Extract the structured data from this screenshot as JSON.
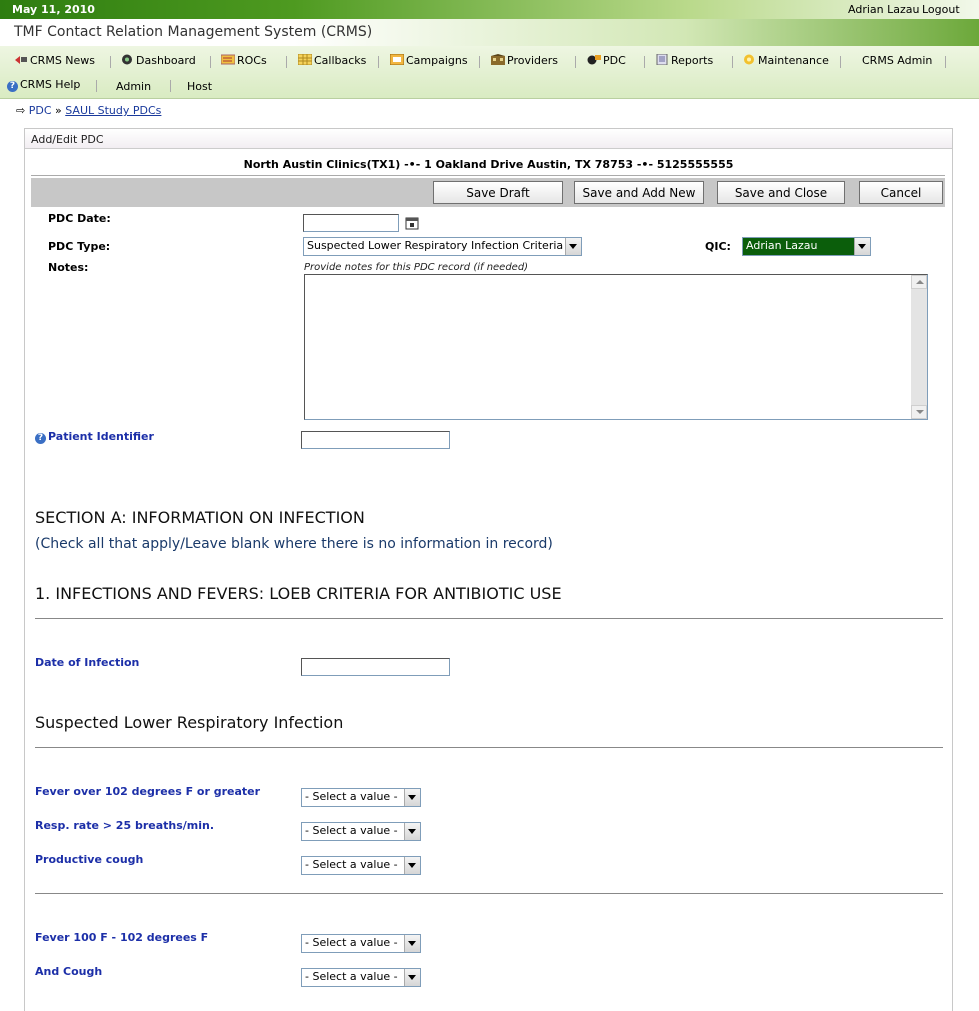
{
  "header": {
    "date": "May 11, 2010",
    "user": "Adrian Lazau",
    "logout": "Logout",
    "app_title": "TMF Contact Relation Management System (CRMS)"
  },
  "nav": [
    {
      "label": "CRMS News",
      "icon": "news-icon"
    },
    {
      "label": "Dashboard",
      "icon": "dashboard-icon"
    },
    {
      "label": "ROCs",
      "icon": "rocs-icon"
    },
    {
      "label": "Callbacks",
      "icon": "callbacks-icon"
    },
    {
      "label": "Campaigns",
      "icon": "campaigns-icon"
    },
    {
      "label": "Providers",
      "icon": "providers-icon"
    },
    {
      "label": "PDC",
      "icon": "pdc-icon"
    },
    {
      "label": "Reports",
      "icon": "reports-icon"
    },
    {
      "label": "Maintenance",
      "icon": "maintenance-icon"
    },
    {
      "label": "CRMS Admin",
      "icon": ""
    },
    {
      "label": "CRMS Help",
      "icon": "help-icon"
    },
    {
      "label": "Admin",
      "icon": ""
    },
    {
      "label": "Host",
      "icon": ""
    }
  ],
  "breadcrumb": {
    "root": "PDC",
    "separator": "»",
    "current": "SAUL Study PDCs"
  },
  "panel": {
    "title": "Add/Edit PDC",
    "provider_info": "North Austin Clinics(TX1)  -•-  1 Oakland Drive Austin, TX 78753  -•-  5125555555",
    "buttons": {
      "save_draft": "Save Draft",
      "save_add_new": "Save and Add New",
      "save_close": "Save and Close",
      "cancel": "Cancel"
    }
  },
  "form": {
    "pdc_date_label": "PDC Date:",
    "pdc_date_value": "",
    "pdc_type_label": "PDC Type:",
    "pdc_type_value": "Suspected Lower Respiratory Infection Criteria",
    "qic_label": "QIC:",
    "qic_value": "Adrian Lazau",
    "notes_label": "Notes:",
    "notes_hint": "Provide notes for this PDC record (if needed)",
    "notes_value": "",
    "patient_identifier_label": "Patient Identifier",
    "patient_identifier_value": ""
  },
  "section_a": {
    "title": "SECTION A: INFORMATION ON INFECTION",
    "subtitle": "(Check all that apply/Leave blank where there is no information in record)",
    "part1_title": "1. INFECTIONS AND FEVERS: LOEB CRITERIA FOR ANTIBIOTIC USE",
    "date_of_infection_label": "Date of Infection",
    "date_of_infection_value": "",
    "subsection_title": "Suspected Lower Respiratory Infection",
    "select_placeholder": "- Select a value -",
    "group1": [
      {
        "label": "Fever over 102 degrees F or greater"
      },
      {
        "label": "Resp. rate > 25 breaths/min."
      },
      {
        "label": "Productive cough"
      }
    ],
    "group2": [
      {
        "label": "Fever 100 F - 102 degrees F"
      },
      {
        "label": "And Cough"
      }
    ]
  },
  "colors": {
    "top_green": "#2e7d10",
    "link_blue": "#1c2fa8",
    "qic_select_bg": "#0b5e0b"
  }
}
